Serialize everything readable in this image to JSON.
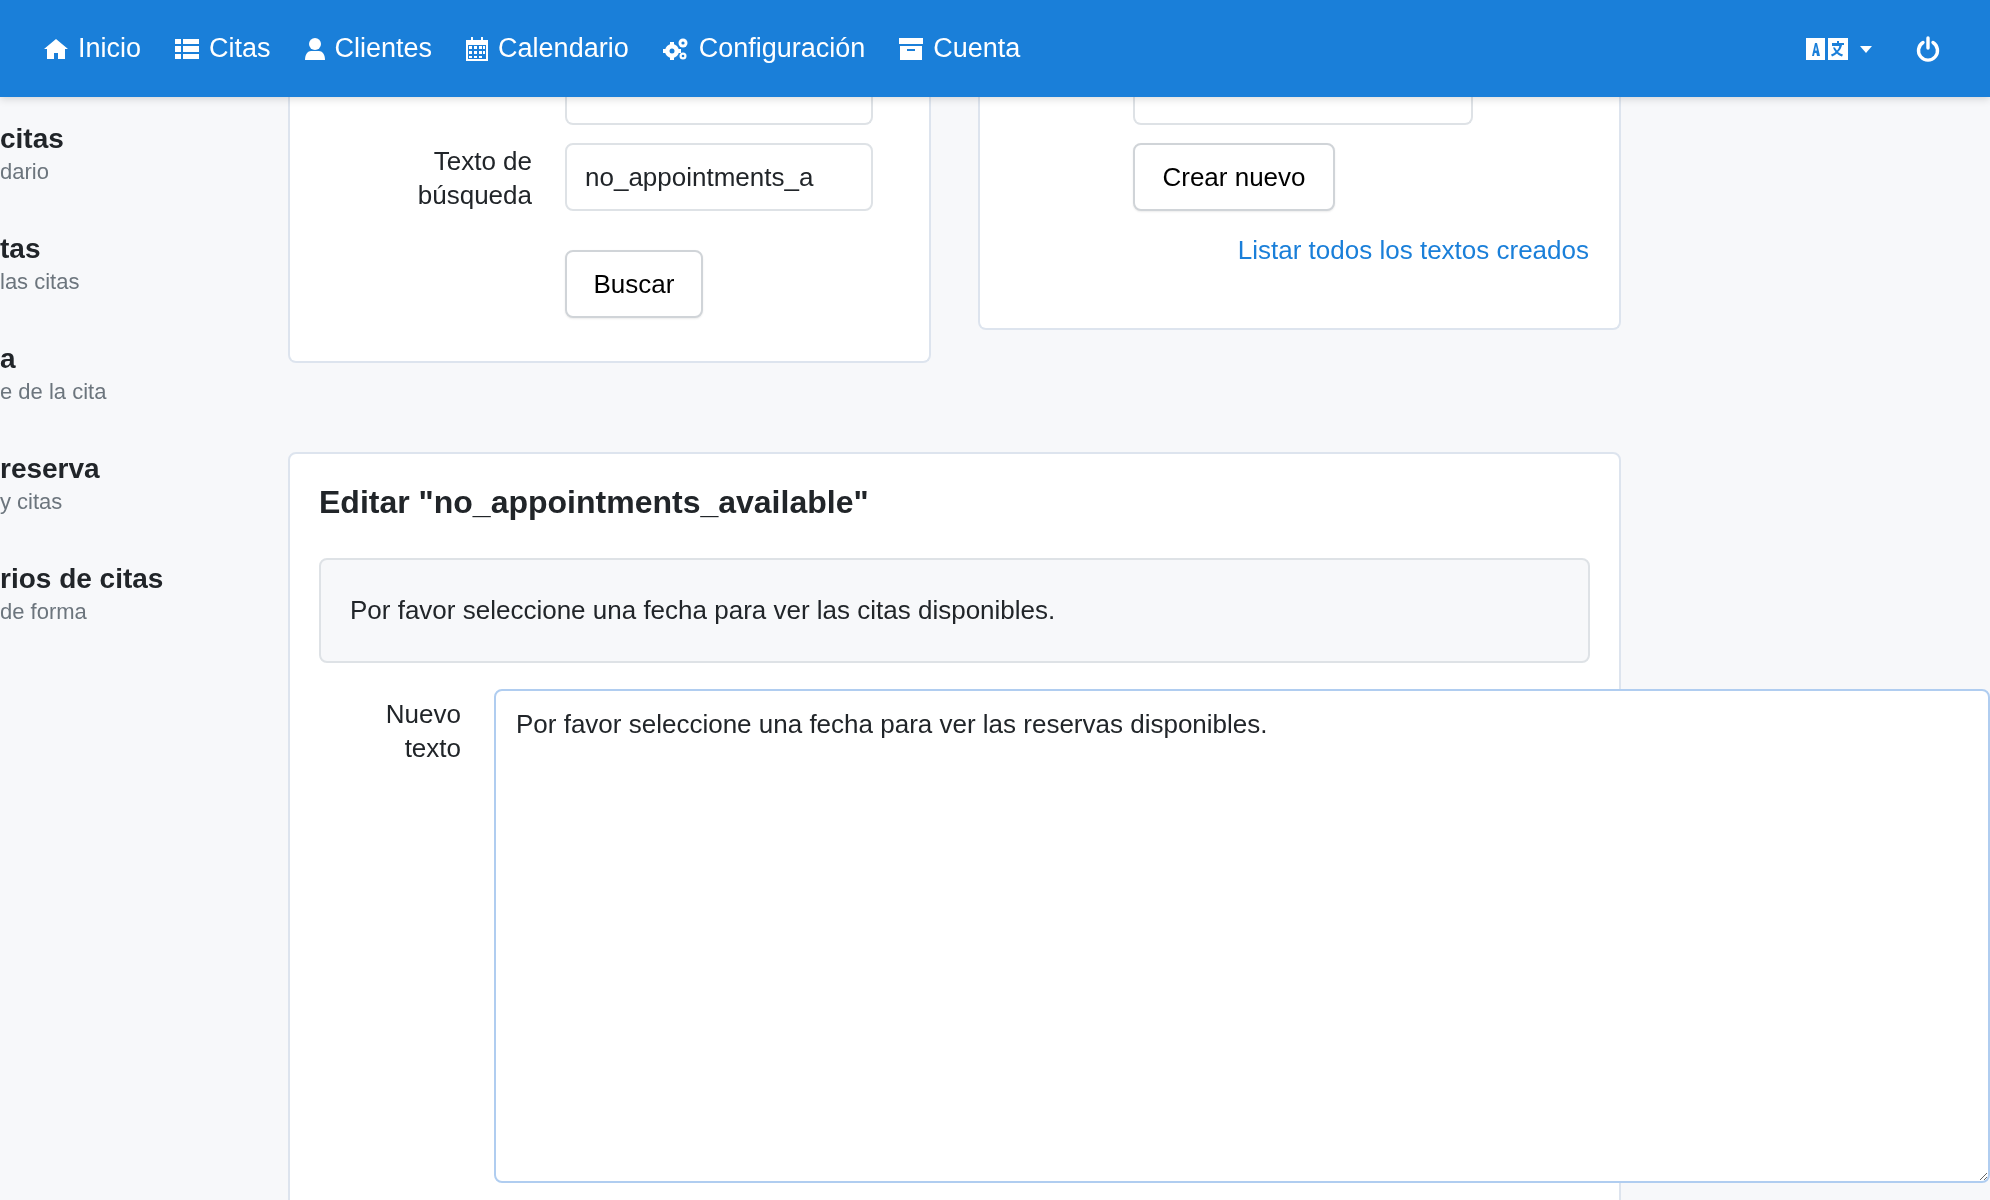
{
  "navbar": {
    "items": [
      {
        "label": "Inicio"
      },
      {
        "label": "Citas"
      },
      {
        "label": "Clientes"
      },
      {
        "label": "Calendario"
      },
      {
        "label": "Configuración"
      },
      {
        "label": "Cuenta"
      }
    ]
  },
  "sidebar": {
    "items": [
      {
        "title": "citas",
        "subtitle": "dario"
      },
      {
        "title": "tas",
        "subtitle": "las citas"
      },
      {
        "title": "a",
        "subtitle": "e de la cita"
      },
      {
        "title": "reserva",
        "subtitle": "y citas"
      },
      {
        "title": "rios de citas",
        "subtitle": "de forma"
      }
    ]
  },
  "search_card": {
    "label": "Texto de búsqueda",
    "search_value": "no_appointments_a",
    "button": "Buscar"
  },
  "create_card": {
    "button": "Crear nuevo",
    "link": "Listar todos los textos creados"
  },
  "edit_card": {
    "title": "Editar \"no_appointments_available\"",
    "current_text": "Por favor seleccione una fecha para ver las citas disponibles.",
    "new_text_label": "Nuevo texto",
    "new_text_value": "Por favor seleccione una fecha para ver las reservas disponibles."
  }
}
